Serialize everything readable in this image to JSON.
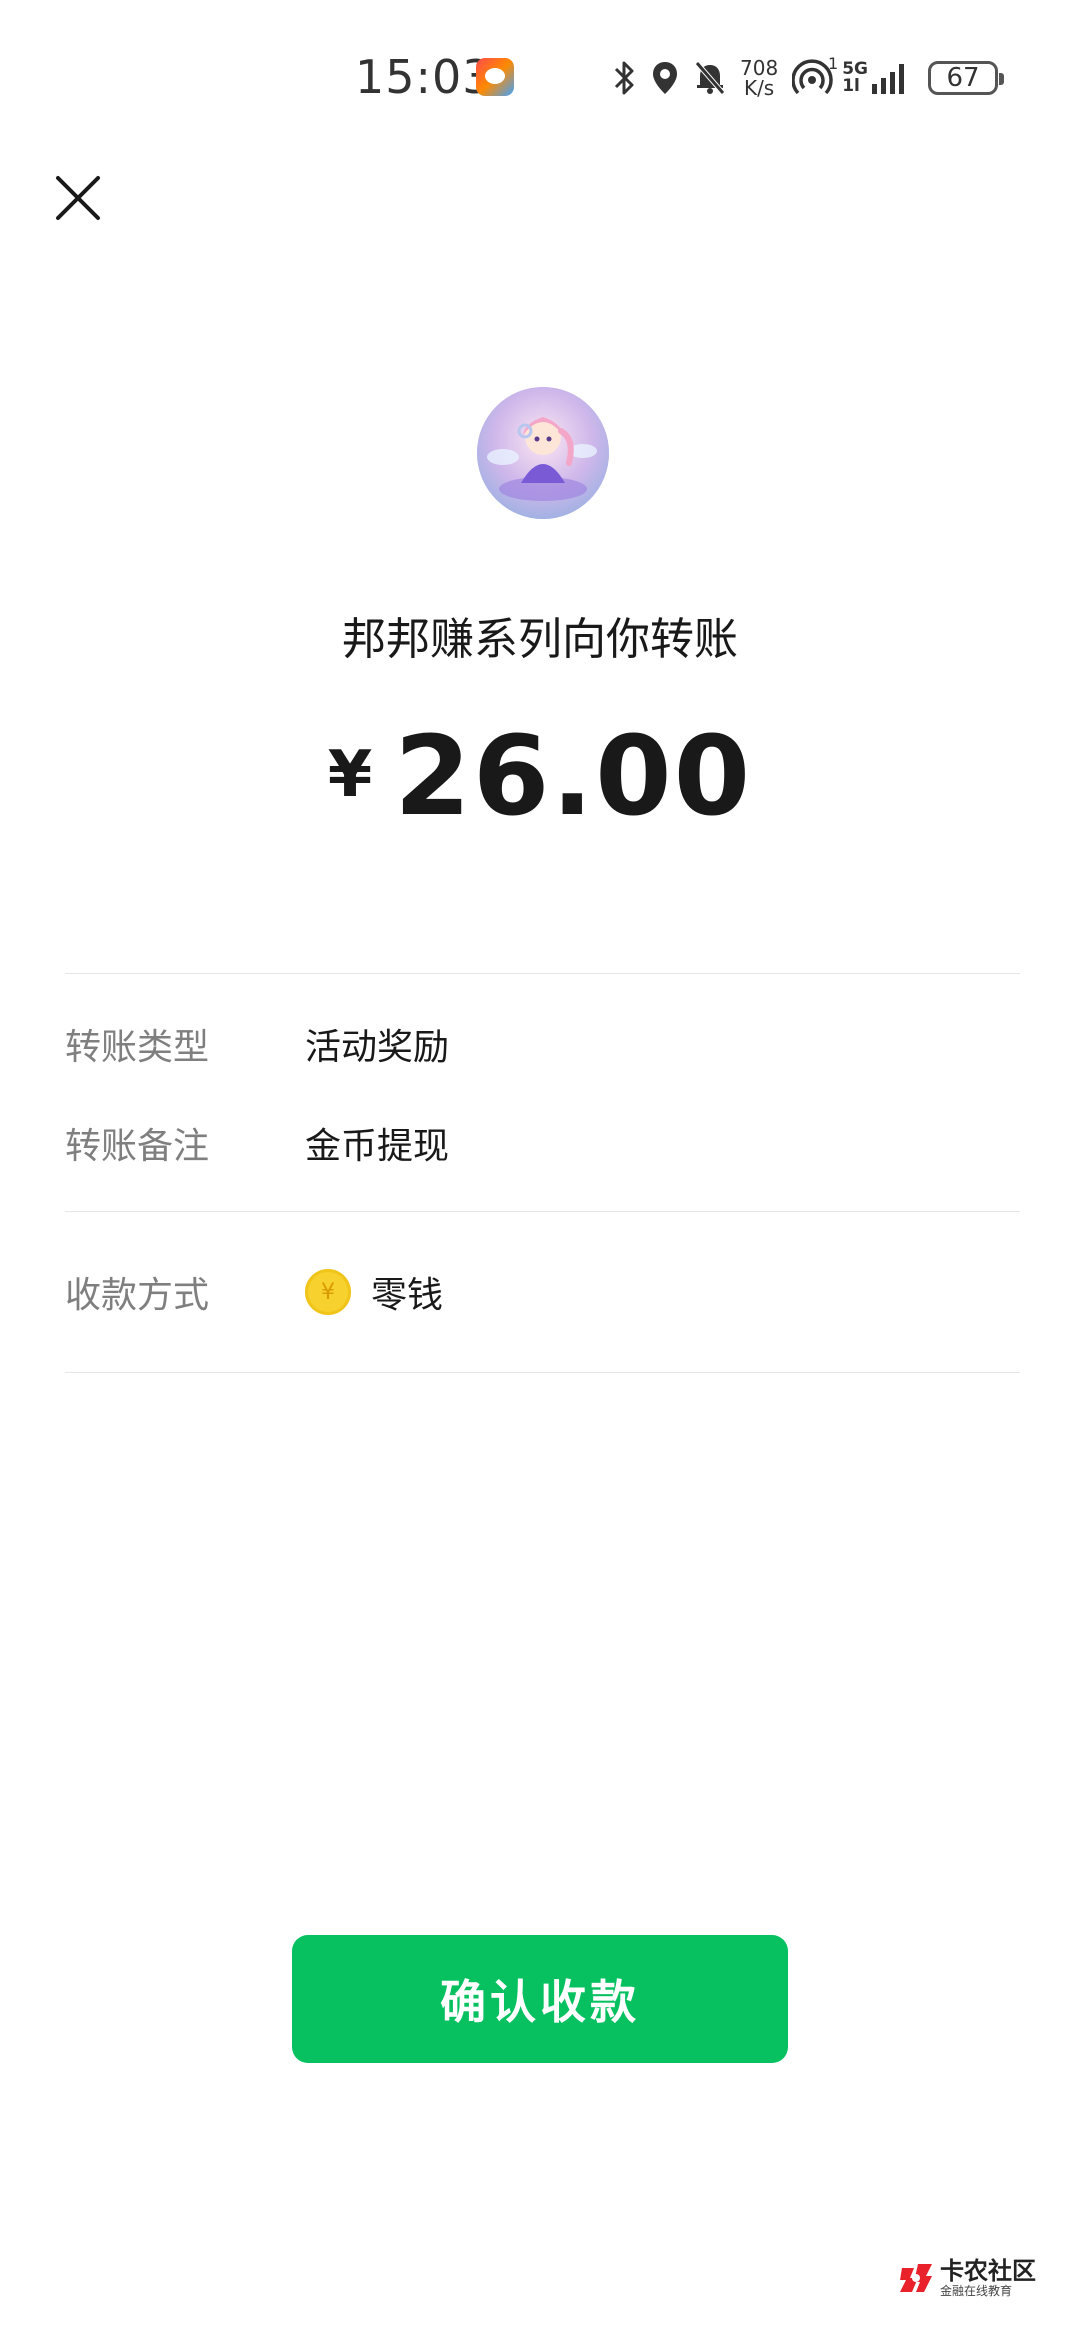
{
  "status_bar": {
    "time": "15:03",
    "net_speed_value": "708",
    "net_speed_unit": "K/s",
    "hotspot_badge": "1",
    "network_type": "5G",
    "network_sub": "1l",
    "battery": "67"
  },
  "transfer": {
    "title": "邦邦赚系列向你转账",
    "currency_symbol": "¥",
    "amount": "26.00"
  },
  "details": {
    "type_label": "转账类型",
    "type_value": "活动奖励",
    "note_label": "转账备注",
    "note_value": "金币提现",
    "method_label": "收款方式",
    "method_value": "零钱",
    "method_icon_glyph": "¥"
  },
  "actions": {
    "confirm_label": "确认收款"
  },
  "watermark": {
    "title": "卡农社区",
    "subtitle": "金融在线教育"
  },
  "colors": {
    "accent_green": "#07c160",
    "label_gray": "#7f7f7f",
    "divider": "#e6e6e6",
    "coin": "#f7d12e"
  }
}
